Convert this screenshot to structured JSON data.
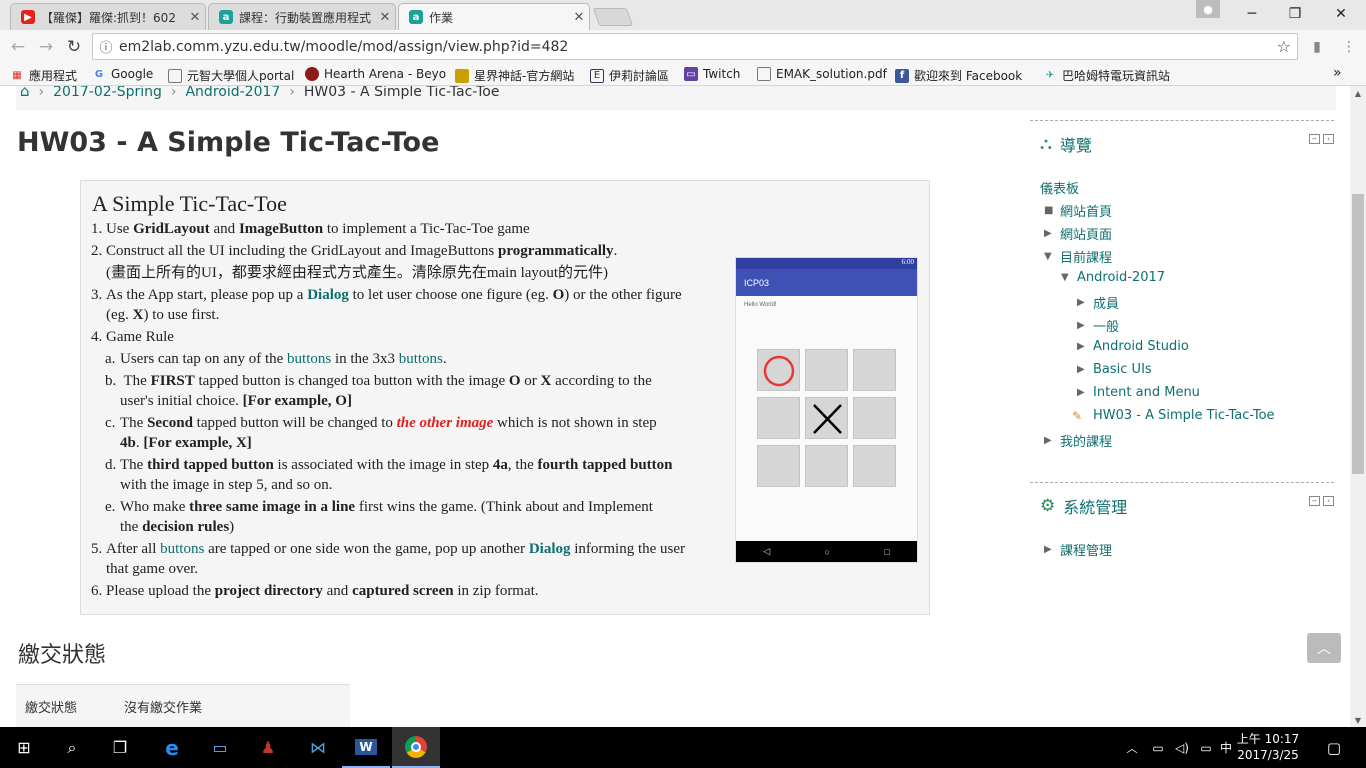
{
  "browser": {
    "tabs": [
      {
        "title": "【羅傑】羅傑:抓到！602",
        "icon": "youtube-icon",
        "color": "#e62117"
      },
      {
        "title": "課程：行動裝置應用程式",
        "icon": "moodle-icon",
        "color": "#1aa39a"
      },
      {
        "title": "作業",
        "icon": "moodle-icon",
        "color": "#1aa39a"
      }
    ],
    "url": "em2lab.comm.yzu.edu.tw/moodle/mod/assign/view.php?id=482",
    "bookmarks": [
      "應用程式",
      "Google",
      "元智大學個人portal",
      "Hearth Arena - Beyo",
      "星界神話-官方網站",
      "伊莉討論區",
      "Twitch",
      "EMAK_solution.pdf",
      "歡迎來到 Facebook",
      "巴哈姆特電玩資訊站"
    ]
  },
  "breadcrumb": [
    "2017-02-Spring",
    "Android-2017",
    "HW03 - A Simple Tic-Tac-Toe"
  ],
  "page_title": "HW03 - A Simple Tic-Tac-Toe",
  "intro": {
    "heading": "A Simple Tic-Tac-Toe",
    "i1": {
      "n": "1.",
      "a": "Use ",
      "b": "GridLayout",
      "c": " and ",
      "d": "ImageButton",
      "e": " to implement a Tic-Tac-Toe game"
    },
    "i2": {
      "n": "2.",
      "a": "Construct all the UI including the GridLayout and ImageButtons ",
      "b": "programmatically",
      "c": ".",
      "line2": "(畫面上所有的UI，都要求經由程式方式產生。清除原先在main layout的元件)"
    },
    "i3": {
      "n": "3.",
      "a": "As the App start, please pop up a ",
      "b": "Dialog",
      "c": " to let user choose one figure (eg. ",
      "d": "O",
      "e": ") or the other figure",
      "f": "(eg. ",
      "g": "X",
      "h": ") to use first."
    },
    "i4": {
      "n": "4.",
      "a": "Game Rule"
    },
    "ia": {
      "n": "a.",
      "a": "Users can tap on any of the ",
      "b": "buttons",
      "c": " in the 3x3 ",
      "d": "buttons",
      "e": "."
    },
    "ib": {
      "n": "b.",
      "a": " The ",
      "b": "FIRST",
      "c": " tapped button is changed toa button with  the image ",
      "d": "O",
      "e": " or ",
      "f": "X",
      "g": "  according to the",
      "h": "user's initial choice. ",
      "i": "[For example, O]"
    },
    "ic": {
      "n": "c.",
      "a": "The ",
      "b": "Second",
      "c": " tapped button will be changed to ",
      "d": "the other image",
      "e": " which is not shown in step",
      "f": "4b",
      "g": ". ",
      "h": "[For example, X]"
    },
    "id": {
      "n": "d.",
      "a": "The ",
      "b": "third tapped button",
      "c": " is associated with the image in step ",
      "d": "4a",
      "e": ", the ",
      "f": "fourth tapped button",
      "g": "with the image in step 5, and so on."
    },
    "ie": {
      "n": "e.",
      "a": "Who make ",
      "b": "three same image in a line",
      "c": " first  wins the game. (Think about and Implement",
      "d": "the ",
      "e": "decision rules",
      "f": ")"
    },
    "i5": {
      "n": "5.",
      "a": "After all ",
      "b": "buttons",
      "c": " are tapped or one side won the game, pop up another ",
      "d": "Dialog",
      "e": " informing the user",
      "f": "that game over."
    },
    "i6": {
      "n": "6.",
      "a": "Please upload the ",
      "b": "project directory",
      "c": " and ",
      "d": "captured screen",
      "e": " in zip format."
    }
  },
  "phone": {
    "status_time": "6:00",
    "app_title": "ICP03",
    "hello": "Hello World!",
    "board": [
      "O",
      "",
      "",
      "",
      "X",
      "",
      "",
      "",
      ""
    ]
  },
  "submission": {
    "heading": "繳交狀態",
    "label": "繳交狀態",
    "value": "沒有繳交作業"
  },
  "navigation": {
    "title": "導覽",
    "items": [
      "儀表板",
      "網站首頁",
      "網站頁面",
      "目前課程",
      "Android-2017",
      "成員",
      "一般",
      "Android Studio",
      "Basic UIs",
      "Intent and Menu",
      "HW03 - A Simple Tic-Tac-Toe",
      "我的課程"
    ]
  },
  "admin": {
    "title": "系統管理",
    "items": [
      "課程管理"
    ]
  },
  "taskbar": {
    "time": "上午 10:17",
    "date": "2017/3/25"
  },
  "colors": {
    "moodle_teal": "#0f6f6f",
    "accent_green": "#2e8b57",
    "highlight_red": "#e02020"
  }
}
